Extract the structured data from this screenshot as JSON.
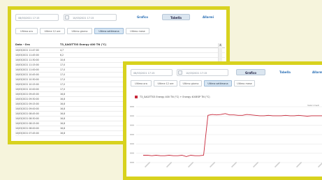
{
  "panel1": {
    "from_date": "08/03/2021 17:15",
    "to_date": "10/03/2021 17:15",
    "buttons": [
      "Grafico",
      "Tabella",
      "Allarmi"
    ],
    "active_button": 1,
    "tabs": [
      "Ultima ora",
      "Ultime 12 ore",
      "Ultimo giorno",
      "Ultima settimana",
      "Ultimo mese"
    ],
    "active_tab": 3,
    "table": {
      "headers": [
        "Data - Ora",
        "T3_SAGITT03 Energy 400 TN (°C)"
      ],
      "rows": [
        [
          "10/03/2021 11:47:00",
          "4,7"
        ],
        [
          "10/03/2021 11:45:00",
          "6,2"
        ],
        [
          "10/03/2021 11:30:00",
          "10,6"
        ],
        [
          "10/03/2021 11:15:00",
          "17,0"
        ],
        [
          "10/03/2021 11:00:00",
          "17,0"
        ],
        [
          "10/03/2021 10:45:00",
          "17,0"
        ],
        [
          "10/03/2021 10:30:00",
          "17,0"
        ],
        [
          "10/03/2021 10:15:00",
          "17,0"
        ],
        [
          "10/03/2021 10:00:00",
          "17,0"
        ],
        [
          "10/03/2021 09:45:00",
          "16,8"
        ],
        [
          "10/03/2021 09:30:00",
          "16,8"
        ],
        [
          "10/03/2021 09:15:00",
          "16,8"
        ],
        [
          "10/03/2021 09:00:00",
          "16,8"
        ],
        [
          "10/03/2021 08:45:00",
          "16,8"
        ],
        [
          "10/03/2021 08:30:00",
          "16,8"
        ],
        [
          "10/03/2021 08:15:00",
          "16,8"
        ],
        [
          "10/03/2021 08:00:00",
          "16,8"
        ],
        [
          "10/03/2021 07:45:00",
          "16,8"
        ]
      ]
    }
  },
  "panel2": {
    "from_date": "08/03/2021 17:15",
    "to_date": "10/03/2021 17:15",
    "buttons": [
      "Grafico",
      "Tabella",
      "Allarmi"
    ],
    "active_button": 0,
    "tabs": [
      "Ultima ora",
      "Ultime 12 ore",
      "Ultimo giorno",
      "Ultima settimana",
      "Ultimo mese"
    ],
    "active_tab": 3,
    "legend": "T3_SAGITT03 Energy 400 TN (°C) + Energy 400ESP TN (°C)",
    "subtitle": "Valori medi"
  },
  "colors": {
    "accent_border": "#d8d21e",
    "series": "#c8283a",
    "link": "#2a6fb5"
  },
  "chart_data": {
    "type": "line",
    "series": [
      {
        "name": "T3_SAGITT03 Energy 400 TN (°C) + Energy 400ESP TN (°C)",
        "values": [
          -4.3,
          -4.3,
          -4.4,
          -4.3,
          -4.4,
          -4.4,
          -4.3,
          -4.4,
          -4.4,
          -4.3,
          -4.6,
          -4.3,
          -4.4,
          -4.4,
          -4.3,
          5.0,
          5.2,
          5.1,
          5.2,
          5.4,
          5.1,
          5.1,
          5.0,
          5.0,
          5.2,
          5.1,
          5.0,
          4.9,
          4.9,
          5.0,
          4.9,
          4.9,
          4.9,
          5.0,
          4.9,
          4.9,
          5.0,
          4.9,
          4.8,
          4.9,
          4.9,
          4.9,
          4.9,
          4.8,
          5.0
        ]
      }
    ],
    "ylim": [
      -6,
      7
    ],
    "grid": true,
    "legend": "top-left"
  }
}
